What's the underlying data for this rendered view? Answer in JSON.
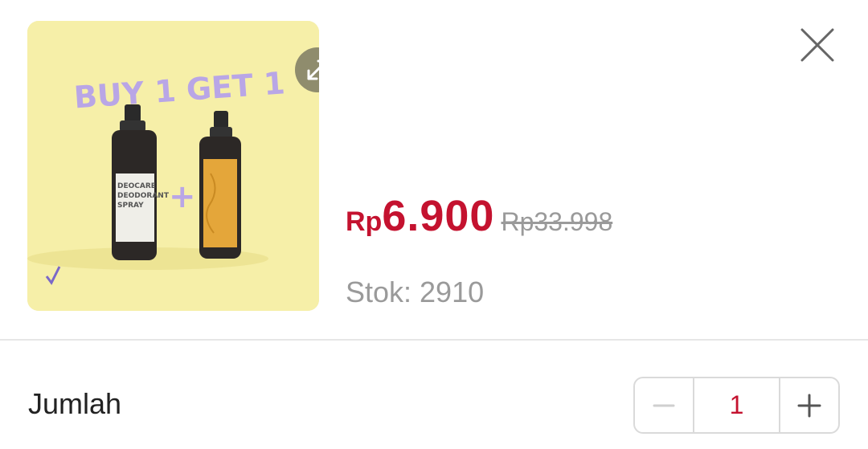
{
  "product": {
    "image_alt": "Deocare Deodorant Spray Buy 1 Get 1",
    "promo_text": "BUY 1 GET 1",
    "plus_sign": "+",
    "bottle_label_lines": [
      "DEOCARE",
      "DEODORANT",
      "SPRAY"
    ]
  },
  "price": {
    "currency": "Rp",
    "amount": "6.900",
    "original": "Rp33.998"
  },
  "stock_text": "Stok: 2910",
  "quantity": {
    "label": "Jumlah",
    "value": "1"
  },
  "icons": {
    "expand": "expand-icon",
    "close": "close-icon",
    "minus": "minus-icon",
    "plus": "plus-icon"
  },
  "colors": {
    "price": "#c4122f",
    "muted": "#9a9a9a",
    "image_bg": "#f6efa8",
    "disabled": "#cfcfcf"
  }
}
